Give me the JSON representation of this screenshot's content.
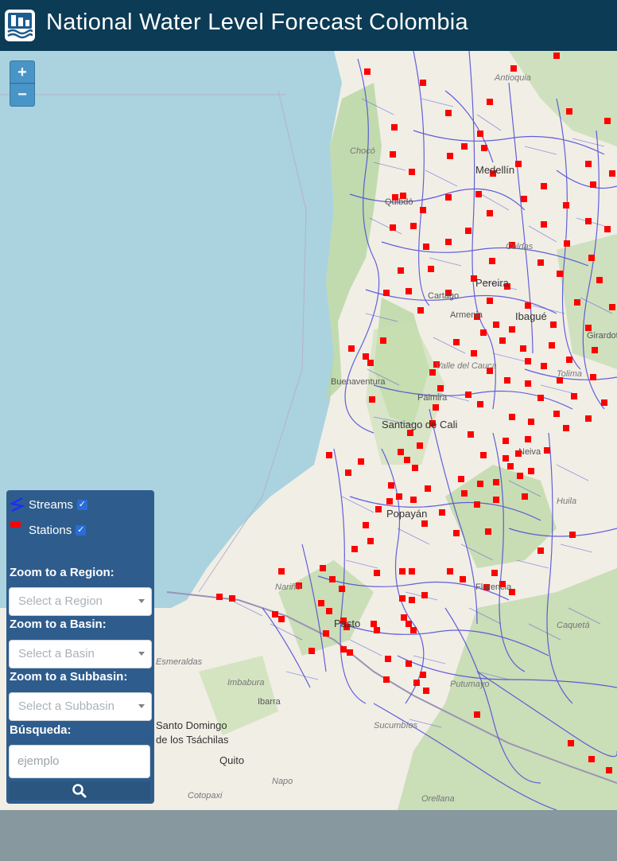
{
  "app": {
    "title": "National Water Level Forecast Colombia"
  },
  "map": {
    "zoom_in": "+",
    "zoom_out": "−",
    "labels": {
      "medellin": "Medellín",
      "quibdo": "Quibdó",
      "pereira": "Pereira",
      "cartago": "Cartago",
      "armenia": "Armenia",
      "ibague": "Ibagué",
      "girardot": "Girardot",
      "buenaventura": "Buenaventura",
      "palmira": "Palmira",
      "cali": "Santiago de Cali",
      "popayan": "Popayán",
      "pasto": "Pasto",
      "florencia": "Florencia",
      "neiva": "Neiva",
      "caldas": "Caldas",
      "choco": "Chocó",
      "antioquia": "Antioquia",
      "valle": "Valle del Cauca",
      "narino": "Nariño",
      "putumayo": "Putumayo",
      "caqueta": "Caquetá",
      "imbabura": "Imbabura",
      "ibarra": "Ibarra",
      "santo_domingo": "Santo Domingo",
      "tsachilas": "de los Tsáchilas",
      "quito": "Quito",
      "sucumbios": "Sucumbíos",
      "napo": "Napo",
      "orellana": "Orellana",
      "cotopaxi": "Cotopaxi",
      "esmeraldas": "Esmeraldas",
      "tolima": "Tolima",
      "huila": "Huila"
    },
    "colors": {
      "ocean": "#aad3df",
      "land": "#f1eee6",
      "forest": "#b9d7a3",
      "stream": "#4a47d8",
      "station": "#ff0000",
      "border": "#9a93b5"
    }
  },
  "panel": {
    "legend": {
      "streams": "Streams",
      "stations": "Stations"
    },
    "region": {
      "label": "Zoom to a Region:",
      "placeholder": "Select a Region"
    },
    "basin": {
      "label": "Zoom to a Basin:",
      "placeholder": "Select a Basin"
    },
    "subbasin": {
      "label": "Zoom to a Subbasin:",
      "placeholder": "Select a Subbasin"
    },
    "search": {
      "label": "Búsqueda:",
      "placeholder": "ejemplo"
    }
  }
}
